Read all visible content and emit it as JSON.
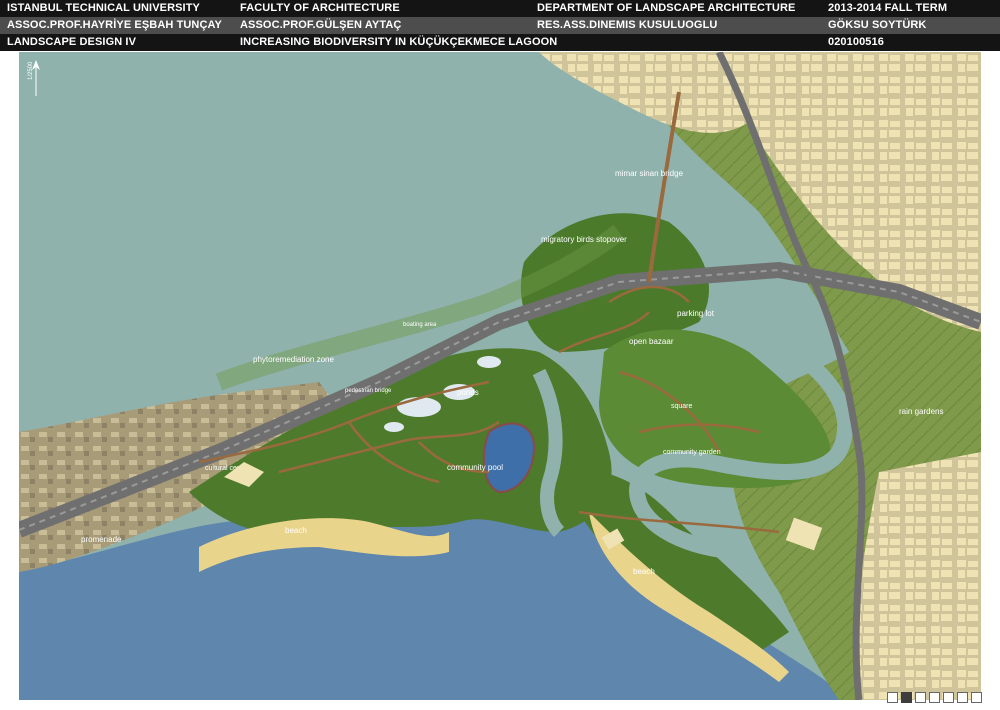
{
  "header": {
    "row1": [
      "ISTANBUL TECHNICAL UNIVERSITY",
      "FACULTY OF ARCHITECTURE",
      "DEPARTMENT OF LANDSCAPE ARCHITECTURE",
      "2013-2014 FALL TERM"
    ],
    "row2": [
      "ASSOC.PROF.HAYRİYE EŞBAH TUNÇAY",
      "ASSOC.PROF.GÜLŞEN AYTAÇ",
      "RES.ASS.DINEMIS KUSULUOGLU",
      "GÖKSU SOYTÜRK"
    ],
    "row3": [
      "LANDSCAPE DESIGN IV",
      "INCREASING BIODIVERSITY IN KÜÇÜKÇEKMECE LAGOON",
      "",
      "020100516"
    ]
  },
  "map": {
    "scale": "1/2500",
    "labels": {
      "mimar_sinan_bridge": "mimar sinan bridge",
      "migratory_birds": "migratory birds stopover",
      "parking_lot": "parking lot",
      "open_bazaar": "open bazaar",
      "boating_area": "boating area",
      "phytoremediation": "phytoremediation zone",
      "pedestrian_bridge": "pedestrian bridge",
      "ponds": "ponds",
      "square": "square",
      "rain_gardens": "rain gardens",
      "community_garden": "community garden",
      "cultural_center": "cultural center",
      "community_pool": "community pool",
      "beach_west": "beach",
      "beach_east": "beach",
      "promenade": "promenade"
    }
  },
  "colors": {
    "lagoon": "#8fb2ad",
    "sea": "#5f86ad",
    "vegetation": "#4e7a2c",
    "urban": "#e9dcaa",
    "road": "#6f6f6f",
    "path": "#9a6a3e",
    "sand": "#e9d48c"
  },
  "pager": {
    "count": 7,
    "active_index": 1
  }
}
